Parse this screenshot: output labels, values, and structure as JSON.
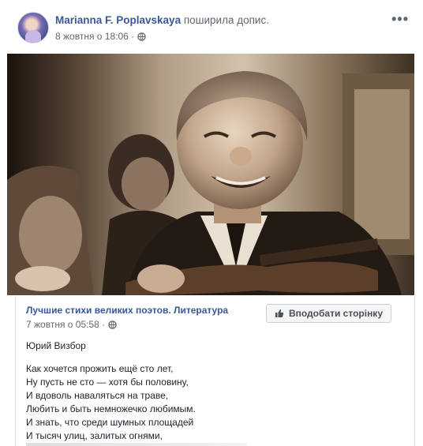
{
  "post": {
    "author_name": "Marianna F. Poplavskaya",
    "shared_text": "поширила допис.",
    "timestamp": "8 жовтня о 18:06 ·",
    "privacy_icon": "globe-icon",
    "more_label": "•••"
  },
  "shared": {
    "page_name": "Лучшие стихи великих поэтов. Литература",
    "timestamp": "7 жовтня о 05:58 ·",
    "privacy_icon": "globe-icon",
    "like_button_label": "Вподобати сторінку",
    "like_button_icon": "thumbs-up-icon",
    "poem_author": "Юрий Визбор",
    "poem_lines": [
      "Как хочется прожить ещё сто лет,",
      "Ну пусть не сто — хотя бы половину,",
      "И вдоволь наваляться на траве,",
      "Любить и быть немножечко любимым.",
      "И знать, что среди шумных площадей",
      "И тысяч улиц, залитых огнями,"
    ]
  },
  "colors": {
    "link_blue": "#385898",
    "meta_gray": "#616770",
    "button_bg": "#f5f6f7",
    "border": "#dddfe2"
  }
}
